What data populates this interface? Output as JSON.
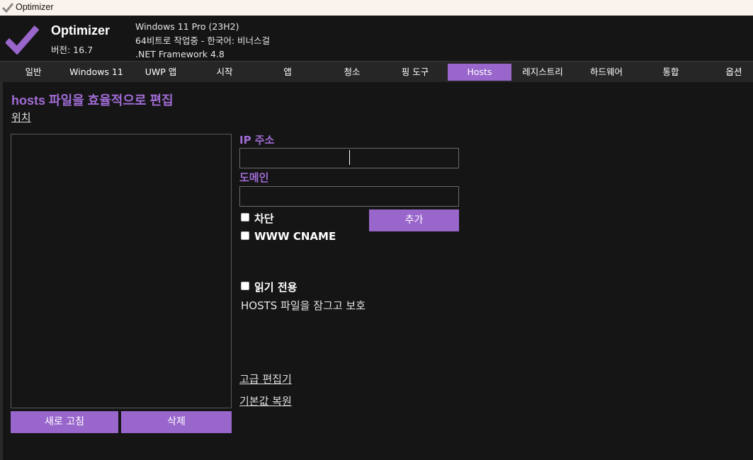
{
  "window": {
    "title": "Optimizer",
    "icon": "check-icon"
  },
  "header": {
    "app_name": "Optimizer",
    "version": "버전: 16.7",
    "sys_os": "Windows 11 Pro (23H2)",
    "sys_arch": "64비트로 작업중 - 한국어: 비너스걸",
    "sys_net": ".NET Framework 4.8",
    "logo_color": "#9966cc"
  },
  "tabs": [
    {
      "label": "일반"
    },
    {
      "label": "Windows 11"
    },
    {
      "label": "UWP 앱"
    },
    {
      "label": "시작"
    },
    {
      "label": "앱"
    },
    {
      "label": "청소"
    },
    {
      "label": "핑 도구"
    },
    {
      "label": "Hosts"
    },
    {
      "label": "레지스트리"
    },
    {
      "label": "하드웨어"
    },
    {
      "label": "통합"
    },
    {
      "label": "옵션"
    }
  ],
  "active_tab": "Hosts",
  "hosts": {
    "title": "hosts 파일을 효율적으로 편집",
    "location_link": "위치",
    "refresh_button": "새로 고침",
    "delete_button": "삭제",
    "ip_label": "IP 주소",
    "ip_value": "",
    "domain_label": "도메인",
    "domain_value": "",
    "block_label": "차단",
    "block_checked": false,
    "www_label": "WWW CNAME",
    "www_checked": false,
    "add_button": "추가",
    "readonly_label": "읽기 전용",
    "readonly_checked": false,
    "lock_desc": "HOSTS 파일을 잠그고 보호",
    "advanced_editor_link": "고급 편집기",
    "restore_default_link": "기본값 복원"
  },
  "colors": {
    "accent": "#9966cc",
    "background": "#151515",
    "tabbar": "#262626"
  }
}
